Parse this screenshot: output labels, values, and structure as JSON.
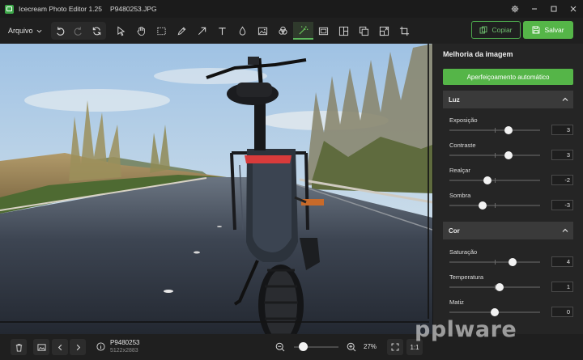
{
  "window": {
    "app_title": "Icecream Photo Editor 1.25",
    "file_title": "P9480253.JPG"
  },
  "toolbar": {
    "menu_label": "Arquivo",
    "tools": [
      "select-icon",
      "hand-icon",
      "crop-select-icon",
      "pen-icon",
      "arrow-icon",
      "text-icon",
      "drop-icon",
      "image-adjust-icon",
      "effects-icon",
      "enhance-icon",
      "frame-icon",
      "collage-icon",
      "layers-icon",
      "resize-icon",
      "crop-icon"
    ],
    "active_tool": "enhance-icon",
    "copy_label": "Copiar",
    "save_label": "Salvar"
  },
  "panel": {
    "title": "Melhoria da imagem",
    "auto_button": "Aperfeiçoamento automático",
    "sections": [
      {
        "name": "Luz",
        "sliders": [
          {
            "label": "Exposição",
            "value": "3",
            "pos": 0.65
          },
          {
            "label": "Contraste",
            "value": "3",
            "pos": 0.65
          },
          {
            "label": "Realçar",
            "value": "-2",
            "pos": 0.42
          },
          {
            "label": "Sombra",
            "value": "-3",
            "pos": 0.37
          }
        ]
      },
      {
        "name": "Cor",
        "sliders": [
          {
            "label": "Saturação",
            "value": "4",
            "pos": 0.7
          },
          {
            "label": "Temperatura",
            "value": "1",
            "pos": 0.55
          },
          {
            "label": "Matiz",
            "value": "0",
            "pos": 0.5
          }
        ]
      }
    ]
  },
  "bottom": {
    "file_name": "P9480253",
    "file_dims": "5122x2883",
    "zoom": "27%",
    "zoom_pos": 0.2,
    "one_to_one": "1:1"
  },
  "watermark": "pplware",
  "colors": {
    "accent": "#55b548",
    "background": "#1f1f1f",
    "panel": "#252525"
  }
}
